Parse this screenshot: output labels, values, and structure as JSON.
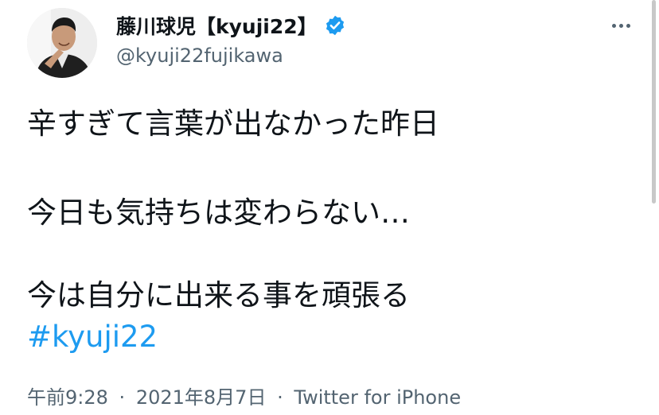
{
  "user": {
    "display_name": "藤川球児【kyuji22】",
    "handle": "@kyuji22fujikawa",
    "verified": true,
    "verified_color": "#1d9bf0"
  },
  "more_icon": "more-dots-icon",
  "tweet": {
    "lines": [
      "辛すぎて言葉が出なかった昨日",
      "今日も気持ちは変わらない…",
      "今は自分に出来る事を頑張る"
    ],
    "hashtag": "#kyuji22",
    "hashtag_color": "#1d9bf0"
  },
  "meta": {
    "time": "午前9:28",
    "separator": "·",
    "date": "2021年8月7日",
    "source": "Twitter for iPhone"
  }
}
